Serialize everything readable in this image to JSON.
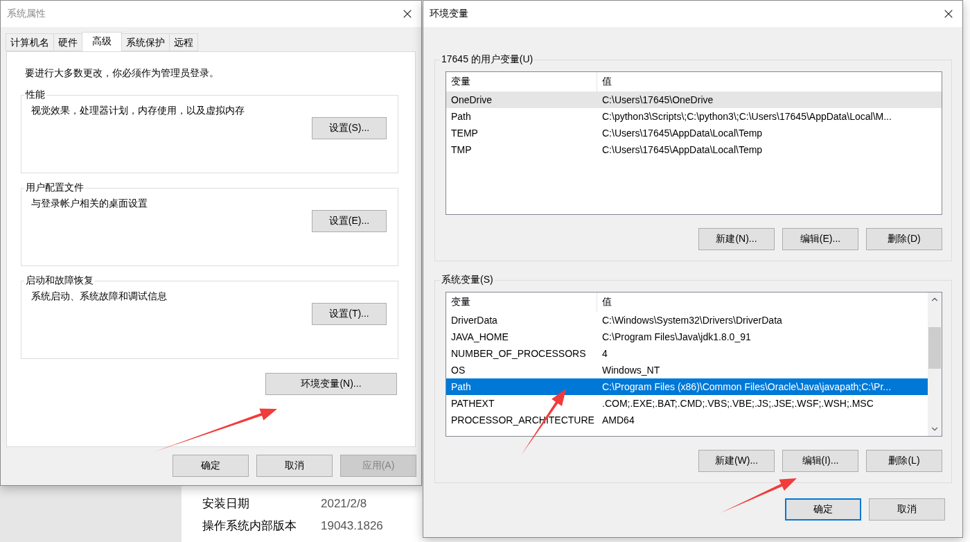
{
  "background_page": {
    "rows": [
      {
        "label": "安装日期",
        "value": "2021/2/8"
      },
      {
        "label": "操作系统内部版本",
        "value": "19043.1826"
      }
    ]
  },
  "system_properties": {
    "title": "系统属性",
    "tabs": [
      {
        "label": "计算机名",
        "selected": false
      },
      {
        "label": "硬件",
        "selected": false
      },
      {
        "label": "高级",
        "selected": true
      },
      {
        "label": "系统保护",
        "selected": false
      },
      {
        "label": "远程",
        "selected": false
      }
    ],
    "notice": "要进行大多数更改，你必须作为管理员登录。",
    "groups": [
      {
        "title": "性能",
        "description": "视觉效果，处理器计划，内存使用，以及虚拟内存",
        "button": "设置(S)..."
      },
      {
        "title": "用户配置文件",
        "description": "与登录帐户相关的桌面设置",
        "button": "设置(E)..."
      },
      {
        "title": "启动和故障恢复",
        "description": "系统启动、系统故障和调试信息",
        "button": "设置(T)..."
      }
    ],
    "env_button": "环境变量(N)...",
    "buttons": [
      {
        "label": "确定",
        "disabled": false
      },
      {
        "label": "取消",
        "disabled": false
      },
      {
        "label": "应用(A)",
        "disabled": true
      }
    ]
  },
  "environment_variables": {
    "title": "环境变量",
    "sections": [
      {
        "title": "17645 的用户变量(U)",
        "focused": false,
        "scrollbar": false,
        "columns": [
          "变量",
          "值"
        ],
        "rows": [
          {
            "name": "OneDrive",
            "value": "C:\\Users\\17645\\OneDrive",
            "selected": true
          },
          {
            "name": "Path",
            "value": "C:\\python3\\Scripts\\;C:\\python3\\;C:\\Users\\17645\\AppData\\Local\\M...",
            "selected": false
          },
          {
            "name": "TEMP",
            "value": "C:\\Users\\17645\\AppData\\Local\\Temp",
            "selected": false
          },
          {
            "name": "TMP",
            "value": "C:\\Users\\17645\\AppData\\Local\\Temp",
            "selected": false
          }
        ],
        "buttons": [
          "新建(N)...",
          "编辑(E)...",
          "删除(D)"
        ]
      },
      {
        "title": "系统变量(S)",
        "focused": true,
        "scrollbar": true,
        "columns": [
          "变量",
          "值"
        ],
        "rows": [
          {
            "name": "DriverData",
            "value": "C:\\Windows\\System32\\Drivers\\DriverData",
            "selected": false
          },
          {
            "name": "JAVA_HOME",
            "value": "C:\\Program Files\\Java\\jdk1.8.0_91",
            "selected": false
          },
          {
            "name": "NUMBER_OF_PROCESSORS",
            "value": "4",
            "selected": false
          },
          {
            "name": "OS",
            "value": "Windows_NT",
            "selected": false
          },
          {
            "name": "Path",
            "value": "C:\\Program Files (x86)\\Common Files\\Oracle\\Java\\javapath;C:\\Pr...",
            "selected": true
          },
          {
            "name": "PATHEXT",
            "value": ".COM;.EXE;.BAT;.CMD;.VBS;.VBE;.JS;.JSE;.WSF;.WSH;.MSC",
            "selected": false
          },
          {
            "name": "PROCESSOR_ARCHITECTURE",
            "value": "AMD64",
            "selected": false
          }
        ],
        "buttons": [
          "新建(W)...",
          "编辑(I)...",
          "删除(L)"
        ]
      }
    ],
    "buttons": [
      {
        "label": "确定",
        "default": true
      },
      {
        "label": "取消",
        "default": false
      }
    ]
  }
}
